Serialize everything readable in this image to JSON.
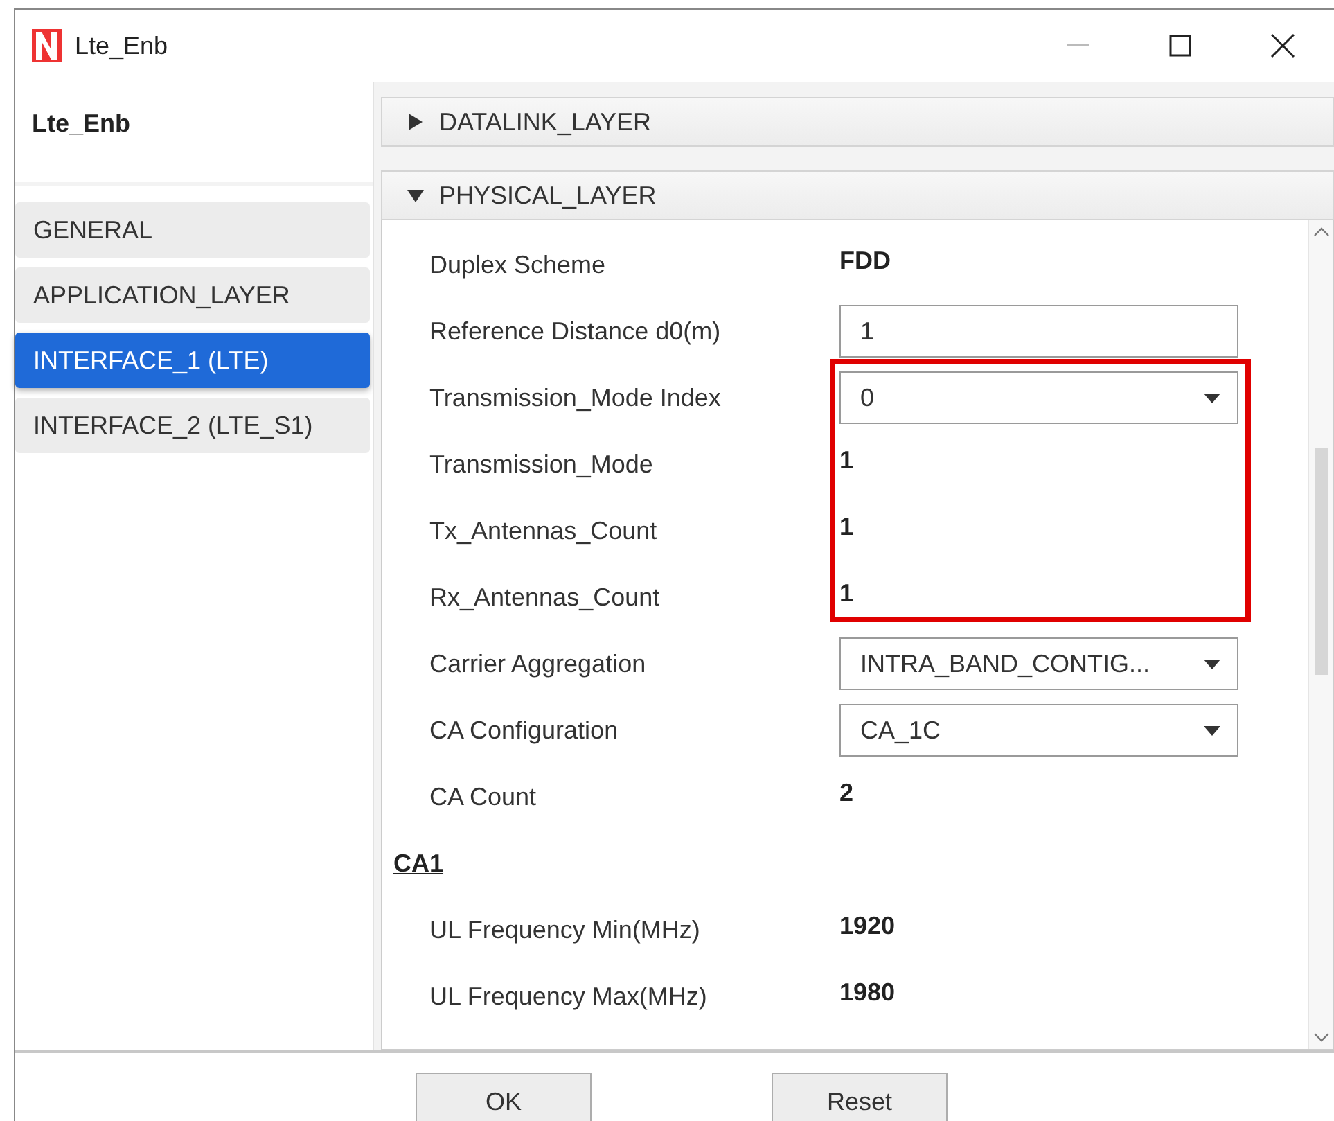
{
  "window": {
    "title": "Lte_Enb"
  },
  "sidebar": {
    "title": "Lte_Enb",
    "items": [
      {
        "label": "GENERAL",
        "selected": false
      },
      {
        "label": "APPLICATION_LAYER",
        "selected": false
      },
      {
        "label": "INTERFACE_1 (LTE)",
        "selected": true
      },
      {
        "label": "INTERFACE_2 (LTE_S1)",
        "selected": false
      }
    ]
  },
  "sections": [
    {
      "title": "DATALINK_LAYER",
      "expanded": false
    },
    {
      "title": "PHYSICAL_LAYER",
      "expanded": true,
      "rows": [
        {
          "kind": "text",
          "label": "Duplex Scheme",
          "value": "FDD",
          "highlighted": false
        },
        {
          "kind": "input",
          "label": "Reference Distance d0(m)",
          "value": "1",
          "highlighted": false
        },
        {
          "kind": "dropdown",
          "label": "Transmission_Mode Index",
          "value": "0",
          "highlighted": true
        },
        {
          "kind": "text",
          "label": "Transmission_Mode",
          "value": "1",
          "highlighted": true
        },
        {
          "kind": "text",
          "label": "Tx_Antennas_Count",
          "value": "1",
          "highlighted": true
        },
        {
          "kind": "text",
          "label": "Rx_Antennas_Count",
          "value": "1",
          "highlighted": true
        },
        {
          "kind": "dropdown",
          "label": "Carrier Aggregation",
          "value": "INTRA_BAND_CONTIG...",
          "highlighted": false
        },
        {
          "kind": "dropdown",
          "label": "CA Configuration",
          "value": "CA_1C",
          "highlighted": false
        },
        {
          "kind": "text",
          "label": "CA Count",
          "value": "2",
          "highlighted": false
        },
        {
          "kind": "heading",
          "label": "CA1",
          "highlighted": false
        },
        {
          "kind": "text",
          "label": "UL Frequency Min(MHz)",
          "value": "1920",
          "highlighted": false
        },
        {
          "kind": "text",
          "label": "UL Frequency Max(MHz)",
          "value": "1980",
          "highlighted": false
        }
      ]
    }
  ],
  "buttons": [
    "OK",
    "Reset"
  ]
}
